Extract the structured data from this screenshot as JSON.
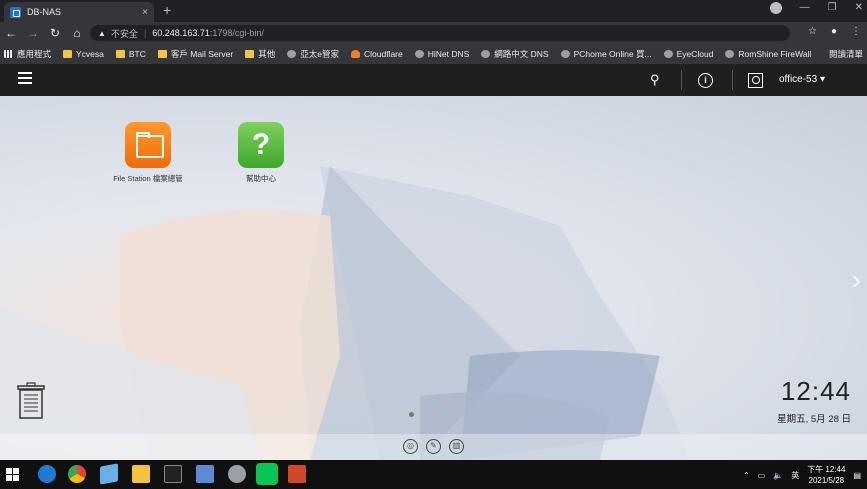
{
  "browser": {
    "tab_title": "DB-NAS",
    "tab_close": "×",
    "new_tab": "+",
    "url_warning": "▲",
    "url_insecure_label": "不安全",
    "url_host": "60.248.163.71",
    "url_path": ":1798/cgi-bin/",
    "bookmarks": [
      {
        "label": "應用程式",
        "icon": "apps-icon"
      },
      {
        "label": "Ycvesa",
        "icon": "folder-icon"
      },
      {
        "label": "BTC",
        "icon": "folder-icon"
      },
      {
        "label": "客戶 Mail Server",
        "icon": "folder-icon"
      },
      {
        "label": "其他",
        "icon": "folder-icon"
      },
      {
        "label": "亞太e管家",
        "icon": "site-icon"
      },
      {
        "label": "Cloudflare",
        "icon": "cloudflare-icon"
      },
      {
        "label": "HiNet DNS",
        "icon": "site-icon"
      },
      {
        "label": "網路中文 DNS",
        "icon": "site-icon"
      },
      {
        "label": "PChome Online 買...",
        "icon": "site-icon"
      },
      {
        "label": "EyeCloud",
        "icon": "site-icon"
      },
      {
        "label": "RomShine FireWall",
        "icon": "site-icon"
      }
    ],
    "bookmarks_more": "閱讀清單"
  },
  "nas": {
    "username": "office-53",
    "apps": [
      {
        "label": "File Station 檔案總管",
        "icon": "folder-icon"
      },
      {
        "label": "幫助中心",
        "icon": "help-icon",
        "glyph": "?"
      }
    ],
    "clock_time": "12:44",
    "clock_date": "星期五, 5月 28 日",
    "page_indicator": {
      "pages": 2,
      "active": 0
    }
  },
  "taskbar": {
    "time": "下午 12:44",
    "date": "2021/5/28"
  }
}
